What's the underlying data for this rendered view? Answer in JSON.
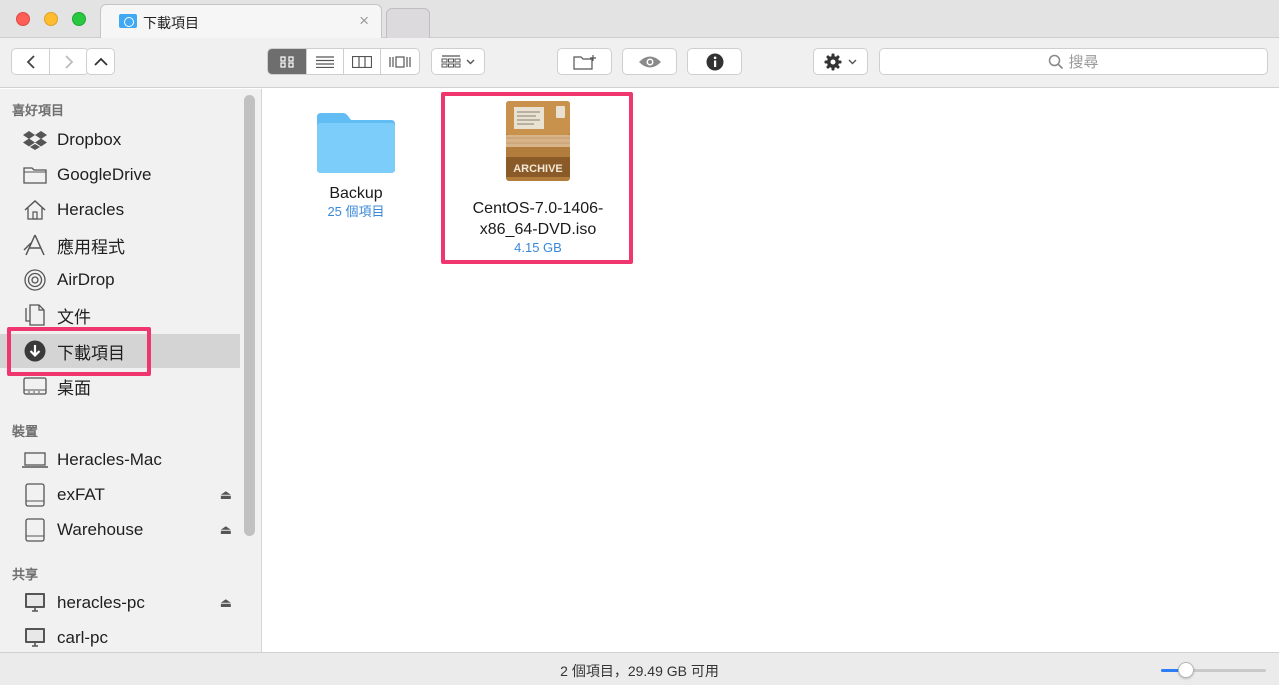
{
  "window": {
    "tab_title": "下載項目",
    "tab_close": "×"
  },
  "toolbar": {
    "search_placeholder": "搜尋",
    "view_modes": [
      "icon-view",
      "list-view",
      "column-view",
      "cover-flow-view"
    ],
    "selected_view": "icon-view"
  },
  "sidebar": {
    "favorites_header": "喜好項目",
    "favorites": [
      {
        "label": "Dropbox",
        "icon": "dropbox-icon"
      },
      {
        "label": "GoogleDrive",
        "icon": "folder-icon"
      },
      {
        "label": "Heracles",
        "icon": "home-icon"
      },
      {
        "label": "應用程式",
        "icon": "applications-icon"
      },
      {
        "label": "AirDrop",
        "icon": "airdrop-icon"
      },
      {
        "label": "文件",
        "icon": "documents-icon"
      },
      {
        "label": "下載項目",
        "icon": "downloads-icon",
        "selected": true
      },
      {
        "label": "桌面",
        "icon": "desktop-icon"
      }
    ],
    "devices_header": "裝置",
    "devices": [
      {
        "label": "Heracles-Mac",
        "icon": "laptop-icon"
      },
      {
        "label": "exFAT",
        "icon": "drive-icon",
        "eject": true
      },
      {
        "label": "Warehouse",
        "icon": "drive-icon",
        "eject": true
      }
    ],
    "shared_header": "共享",
    "shared": [
      {
        "label": "heracles-pc",
        "icon": "pc-icon",
        "eject": true
      },
      {
        "label": "carl-pc",
        "icon": "pc-icon"
      }
    ],
    "eject_glyph": "⏏"
  },
  "files": [
    {
      "name": "Backup",
      "meta": "25 個項目",
      "icon": "folder-icon"
    },
    {
      "name_line1": "CentOS-7.0-1406-",
      "name_line2": "x86_64-DVD.iso",
      "meta": "4.15 GB",
      "icon": "archive-icon",
      "icon_text": "ARCHIVE"
    }
  ],
  "status": {
    "text": "2 個項目，29.49 GB 可用",
    "zoom_level": 0.24
  },
  "colors": {
    "highlight": "#f0366e",
    "accent": "#2e7cf6",
    "folder": "#3fa9f5"
  }
}
